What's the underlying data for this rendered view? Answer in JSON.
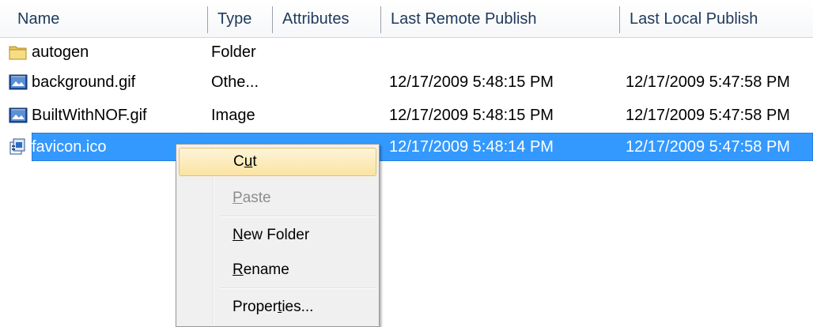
{
  "columns": {
    "name": "Name",
    "type": "Type",
    "attributes": "Attributes",
    "last_remote_publish": "Last Remote Publish",
    "last_local_publish": "Last Local Publish"
  },
  "rows": [
    {
      "name": "autogen",
      "type": "Folder",
      "attributes": "",
      "remote": "",
      "local": "",
      "icon": "folder-icon"
    },
    {
      "name": "background.gif",
      "type": "Othe...",
      "attributes": "",
      "remote": "12/17/2009 5:48:15 PM",
      "local": "12/17/2009 5:47:58 PM",
      "icon": "image-file-icon"
    },
    {
      "name": "BuiltWithNOF.gif",
      "type": "Image",
      "attributes": "",
      "remote": "12/17/2009 5:48:15 PM",
      "local": "12/17/2009 5:47:58 PM",
      "icon": "image-file-icon"
    },
    {
      "name": "favicon.ico",
      "type": "",
      "attributes": "",
      "remote": "12/17/2009 5:48:14 PM",
      "local": "12/17/2009 5:47:58 PM",
      "icon": "ico-file-icon",
      "selected": true
    }
  ],
  "context_menu": {
    "cut": {
      "before": "C",
      "mnemonic": "u",
      "after": "t"
    },
    "paste": {
      "before": "",
      "mnemonic": "P",
      "after": "aste",
      "disabled": true
    },
    "new_folder": {
      "before": "",
      "mnemonic": "N",
      "after": "ew Folder"
    },
    "rename": {
      "before": "",
      "mnemonic": "R",
      "after": "ename"
    },
    "properties": {
      "before": "Proper",
      "mnemonic": "t",
      "after": "ies..."
    }
  },
  "colors": {
    "selection": "#3399ff",
    "header_text": "#1e395b",
    "menu_hover": "#fbe3a1",
    "disabled_text": "#8d8d8d"
  }
}
